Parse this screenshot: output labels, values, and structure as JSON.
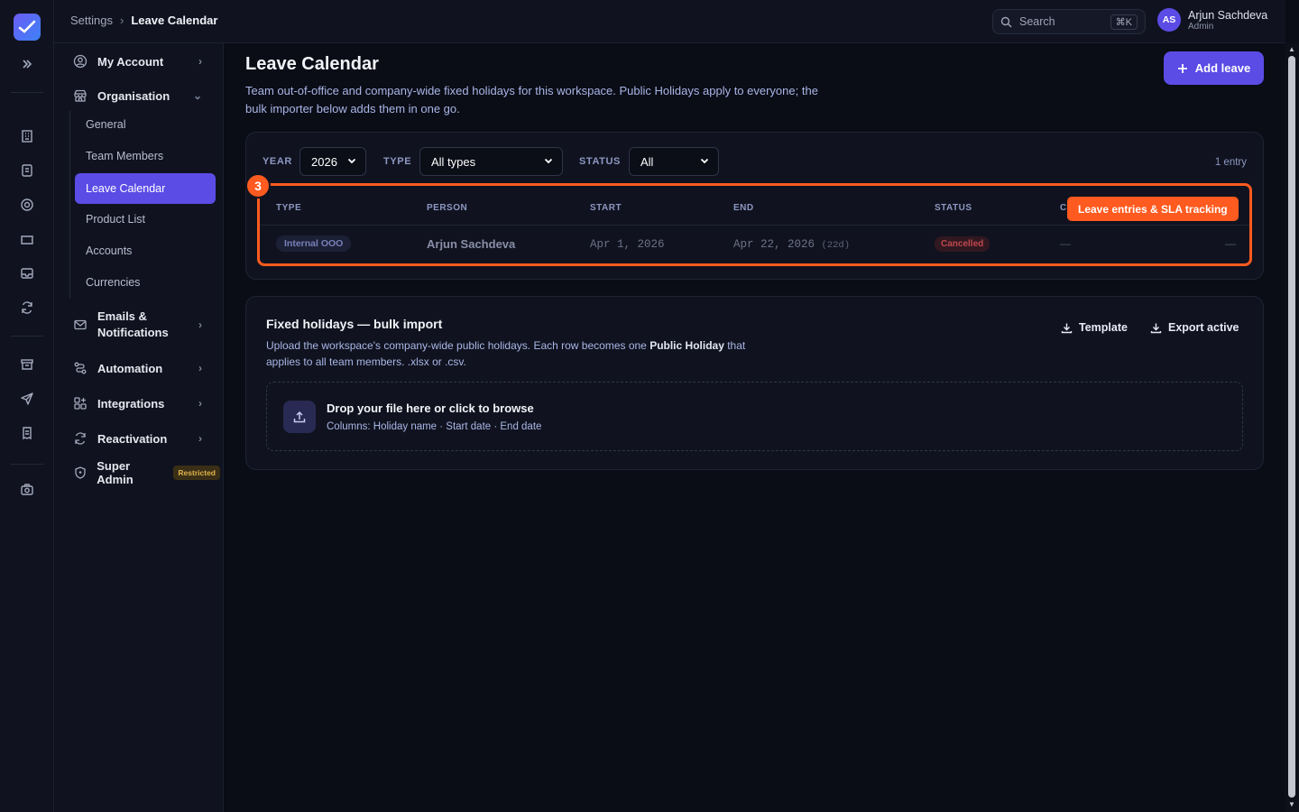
{
  "breadcrumb": {
    "parent": "Settings",
    "separator": "›",
    "current": "Leave Calendar"
  },
  "search": {
    "placeholder": "Search",
    "shortcut": "⌘K"
  },
  "user": {
    "initials": "AS",
    "name": "Arjun Sachdeva",
    "role": "Admin"
  },
  "nav": {
    "my_account": "My Account",
    "organisation": "Organisation",
    "org_items": [
      "General",
      "Team Members",
      "Leave Calendar",
      "Product List",
      "Accounts",
      "Currencies"
    ],
    "emails_line1": "Emails &",
    "emails_line2": "Notifications",
    "automation": "Automation",
    "integrations": "Integrations",
    "reactivation": "Reactivation",
    "super_admin": "Super Admin",
    "restricted_badge": "Restricted"
  },
  "page": {
    "title": "Leave Calendar",
    "description": "Team out-of-office and company-wide fixed holidays for this workspace. Public Holidays apply to everyone; the bulk importer below adds them in one go.",
    "add_button": "Add leave"
  },
  "filters": {
    "year_label": "YEAR",
    "year_value": "2026",
    "type_label": "TYPE",
    "type_value": "All types",
    "status_label": "STATUS",
    "status_value": "All",
    "entry_count": "1 entry"
  },
  "table": {
    "headers": [
      "TYPE",
      "PERSON",
      "START",
      "END",
      "STATUS",
      "C"
    ],
    "rows": [
      {
        "type": "Internal OOO",
        "person": "Arjun Sachdeva",
        "start": "Apr 1, 2026",
        "end": "Apr 22, 2026",
        "duration": "(22d)",
        "status": "Cancelled",
        "col6": "—",
        "action": "—"
      }
    ]
  },
  "annotation": {
    "step": "3",
    "callout": "Leave entries & SLA tracking",
    "color": "#ff5a1f"
  },
  "bulk": {
    "title": "Fixed holidays — bulk import",
    "desc_pre": "Upload the workspace's company-wide public holidays. Each row becomes one ",
    "desc_bold": "Public Holiday",
    "desc_post": " that applies to all team members. .xlsx or .csv.",
    "template_label": "Template",
    "export_label": "Export active",
    "drop_title": "Drop your file here or click to browse",
    "drop_hint": "Columns: Holiday name · Start date · End date"
  },
  "colors": {
    "accent": "#5b4ce6",
    "background": "#0a0c16",
    "panel": "#10131f"
  }
}
